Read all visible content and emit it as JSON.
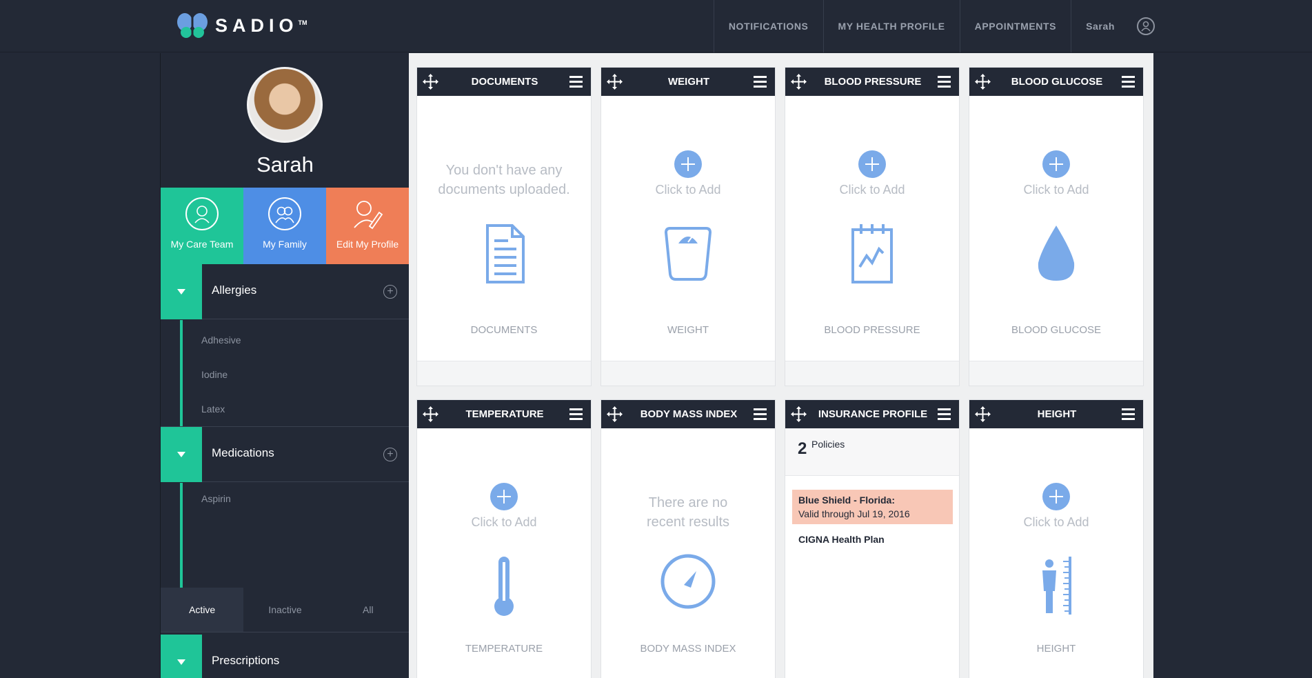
{
  "brand": {
    "name": "SADIO",
    "tm": "TM"
  },
  "nav": {
    "notifications": "NOTIFICATIONS",
    "health_profile": "MY HEALTH PROFILE",
    "appointments": "APPOINTMENTS",
    "user": "Sarah"
  },
  "profile": {
    "name": "Sarah"
  },
  "tiles": {
    "care_team": "My Care Team",
    "family": "My Family",
    "edit": "Edit My Profile"
  },
  "allergies": {
    "title": "Allergies",
    "items": [
      "Adhesive",
      "Iodine",
      "Latex"
    ]
  },
  "medications": {
    "title": "Medications",
    "items": [
      "Aspirin"
    ]
  },
  "filters": {
    "active": "Active",
    "inactive": "Inactive",
    "all": "All"
  },
  "prescriptions": {
    "title": "Prescriptions"
  },
  "cards": {
    "documents": {
      "title": "DOCUMENTS",
      "message": "You don't have any documents uploaded.",
      "label": "DOCUMENTS"
    },
    "weight": {
      "title": "WEIGHT",
      "add": "Click to Add",
      "label": "WEIGHT"
    },
    "blood_pressure": {
      "title": "BLOOD PRESSURE",
      "add": "Click to Add",
      "label": "BLOOD PRESSURE"
    },
    "blood_glucose": {
      "title": "BLOOD GLUCOSE",
      "add": "Click to Add",
      "label": "BLOOD GLUCOSE"
    },
    "temperature": {
      "title": "TEMPERATURE",
      "add": "Click to Add",
      "label": "TEMPERATURE"
    },
    "bmi": {
      "title": "BODY MASS INDEX",
      "message": "There are no recent results",
      "label": "BODY MASS INDEX"
    },
    "insurance": {
      "title": "INSURANCE PROFILE",
      "count": "2",
      "count_label": "Policies",
      "policy1_name": "Blue Shield - Florida:",
      "policy1_valid": "Valid through Jul 19, 2016",
      "policy2_name": "CIGNA Health Plan"
    },
    "height": {
      "title": "HEIGHT",
      "add": "Click to Add",
      "label": "HEIGHT"
    }
  },
  "colors": {
    "accent_green": "#1fc598",
    "accent_blue": "#4e8ee5",
    "accent_orange": "#ef7e57",
    "icon_blue": "#7aaae9",
    "dark": "#232936"
  }
}
